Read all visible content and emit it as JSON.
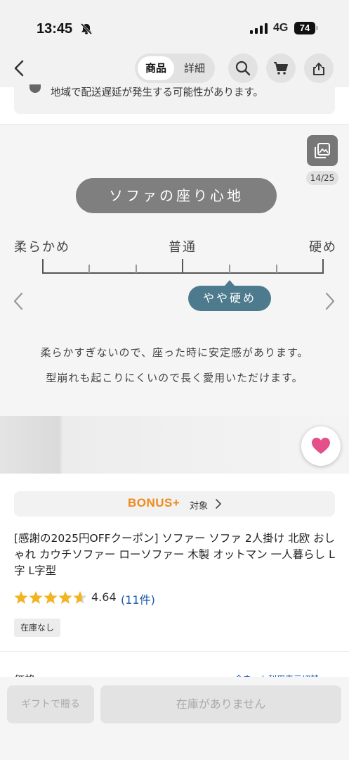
{
  "status_bar": {
    "time": "13:45",
    "network": "4G",
    "battery": "74"
  },
  "nav": {
    "tabs": [
      {
        "label": "商品",
        "active": true
      },
      {
        "label": "詳細",
        "active": false
      }
    ],
    "icons": [
      "back-icon",
      "search-icon",
      "cart-icon",
      "share-icon"
    ]
  },
  "notice": {
    "text": "地域で配送遅延が発生する可能性があります。"
  },
  "gallery": {
    "counter": "14/25",
    "title": "ソファの座り心地",
    "scale_left": "柔らかめ",
    "scale_center": "普通",
    "scale_right": "硬め",
    "marker_label": "やや硬め",
    "marker_position": 0.5,
    "desc_line1": "柔らかすぎないので、座った時に安定感があります。",
    "desc_line2": "型崩れも起こりにくいので長く愛用いただけます。"
  },
  "bonus": {
    "logo": "BONUS+",
    "label": "対象"
  },
  "product": {
    "title": "[感謝の2025円OFFクーポン] ソファー ソファ 2人掛け 北欧 おしゃれ カウチソファー ローソファー 木製 オットマン 一人暮らし L字 L字型",
    "rating": "4.64",
    "rating_value": 4.64,
    "reviews": "(11件)",
    "stock": "在庫なし"
  },
  "price": {
    "label": "価格",
    "link": "全ネット利用表示切替"
  },
  "bottom": {
    "gift_label": "ギフトで贈る",
    "cart_label": "在庫がありません"
  },
  "colors": {
    "accent_blue": "#4d7a8c",
    "bonus_orange": "#ef8a1a",
    "heart_pink": "#e4508a",
    "star_gold": "#f1b422",
    "link_blue": "#1a56a8"
  }
}
